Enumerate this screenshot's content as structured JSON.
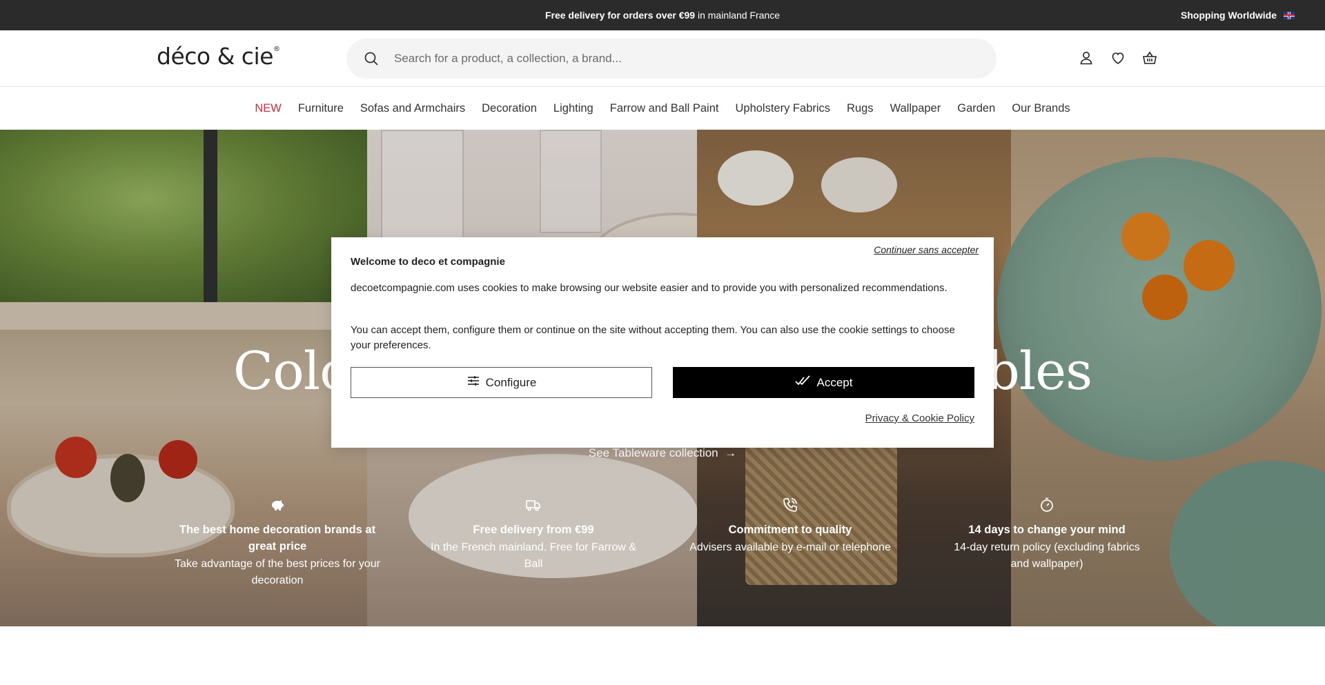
{
  "topbar": {
    "promo_bold": "Free delivery for orders over €99",
    "promo_rest": " in mainland France",
    "worldwide": "Shopping Worldwide"
  },
  "header": {
    "logo": "déco & cie",
    "logo_mark": "®",
    "search_placeholder": "Search for a product, a collection, a brand...",
    "icons": [
      "user-icon",
      "heart-icon",
      "basket-icon"
    ]
  },
  "nav": {
    "items": [
      "NEW",
      "Furniture",
      "Sofas and Armchairs",
      "Decoration",
      "Lighting",
      "Farrow and Ball Paint",
      "Upholstery Fabrics",
      "Rugs",
      "Wallpaper",
      "Garden",
      "Our Brands"
    ],
    "new_color": "#d52b3c"
  },
  "hero": {
    "title": "Colour                                 tables",
    "cta": "See Tableware collection",
    "features": [
      {
        "icon": "piggy-bank-icon",
        "title": "The best home decoration brands at great price",
        "desc": "Take advantage of the best prices for your decoration"
      },
      {
        "icon": "truck-icon",
        "title": "Free delivery from €99",
        "desc": "In the French mainland. Free for Farrow & Ball"
      },
      {
        "icon": "phone-icon",
        "title": "Commitment to quality",
        "desc": "Advisers available by e-mail or telephone"
      },
      {
        "icon": "clock-icon",
        "title": "14 days to change your mind",
        "desc": "14-day return policy (excluding fabrics and wallpaper)"
      }
    ]
  },
  "cookie": {
    "skip": "Continuer sans accepter",
    "title": "Welcome to deco et compagnie",
    "para1": "decoetcompagnie.com uses cookies to make browsing our website easier and to provide you with personalized recommendations.",
    "para2": "You can accept them, configure them or continue on the site without accepting them. You can also use the cookie settings to choose your preferences.",
    "configure": "Configure",
    "accept": "Accept",
    "policy": "Privacy & Cookie Policy"
  },
  "colors": {
    "topbar_bg": "#2b2b2b",
    "accent_red": "#d52b3c",
    "accept_bg": "#000000"
  }
}
